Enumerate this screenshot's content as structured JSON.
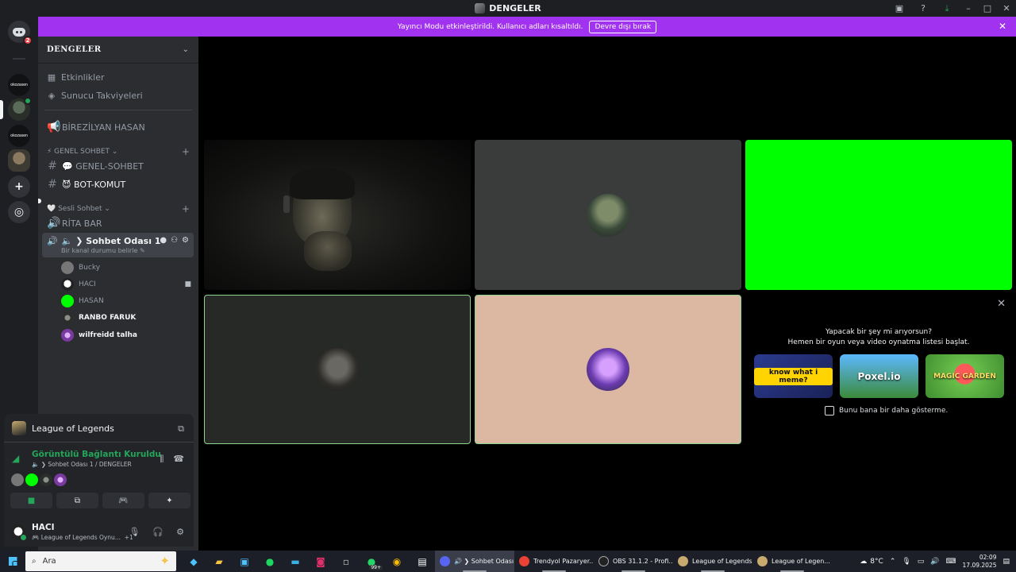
{
  "window": {
    "title": "DENGELER",
    "inbox_icon": "inbox-icon",
    "help_icon": "help-icon",
    "download_icon": "download-icon"
  },
  "rail": {
    "home_badge": "2",
    "servers": [
      {
        "label": "okozasen"
      },
      {
        "label": "okozasen"
      }
    ]
  },
  "banner": {
    "text": "Yayıncı Modu etkinleştirildi. Kullanıcı adları kısaltıldı.",
    "button": "Devre dışı bırak"
  },
  "sidebar": {
    "server_name": "DENGELER",
    "nav": [
      {
        "label": "Etkinlikler",
        "icon": "calendar-icon"
      },
      {
        "label": "Sunucu Takviyeleri",
        "icon": "boost-icon"
      }
    ],
    "stage_channel": "BİREZİLYAN HASAN",
    "categories": [
      {
        "label": "⚡ GENEL SOHBET ⌄"
      },
      {
        "label": "🤍 Sesli Sohbet ⌄"
      }
    ],
    "text_channels": [
      {
        "label": "💬 GENEL-SOHBET"
      },
      {
        "label": "😈 BOT-KOMUT"
      }
    ],
    "voice_channels": [
      {
        "label": "RİTA BAR"
      }
    ],
    "active_voice": {
      "label": "🔈 ❯ Sohbet Odası 1",
      "status": "Bir kanal durumu belirle ✎"
    },
    "members": [
      {
        "name": "Bucky",
        "color": "#777777"
      },
      {
        "name": "HACI",
        "color": "#ffffff"
      },
      {
        "name": "HASAN",
        "color": "#00ff00"
      },
      {
        "name": "RANBO FARUK",
        "color": "#444a44"
      },
      {
        "name": "wilfreidd talha",
        "color": "#b06ad8"
      }
    ]
  },
  "activity": {
    "game": "League of Legends",
    "connection_status": "Görüntülü Bağlantı Kuruldu",
    "connection_where": "🔈 ❯ Sohbet Odası 1 / DENGELER",
    "user": {
      "name": "HACI",
      "status": "🎮 League of Legends Oynu...",
      "extra": "+1"
    }
  },
  "stage": {
    "promo": {
      "line1": "Yapacak bir şey mi arıyorsun?",
      "line2": "Hemen bir oyun veya video oynatma listesi başlat.",
      "games": [
        {
          "title": "know what i meme?"
        },
        {
          "title": "Poxel.io"
        },
        {
          "title": "MAGIC GARDEN"
        }
      ],
      "checkbox_label": "Bunu bana bir daha gösterme."
    }
  },
  "taskbar": {
    "search_placeholder": "Ara",
    "whatsapp_badge": "99+",
    "apps": [
      {
        "label": "🔊 ❯ Sohbet Odası ...",
        "color": "#5865f2",
        "active": true
      },
      {
        "label": "Trendyol Pazaryer...",
        "color": "#ea4335",
        "active": false
      },
      {
        "label": "OBS 31.1.2 - Profi...",
        "color": "#222222",
        "active": false
      },
      {
        "label": "League of Legends",
        "color": "#c8aa6e",
        "active": false
      },
      {
        "label": "League of Legen...",
        "color": "#c8aa6e",
        "active": false
      }
    ],
    "weather": "8°C",
    "time": "02:09",
    "date": "17.09.2025"
  }
}
